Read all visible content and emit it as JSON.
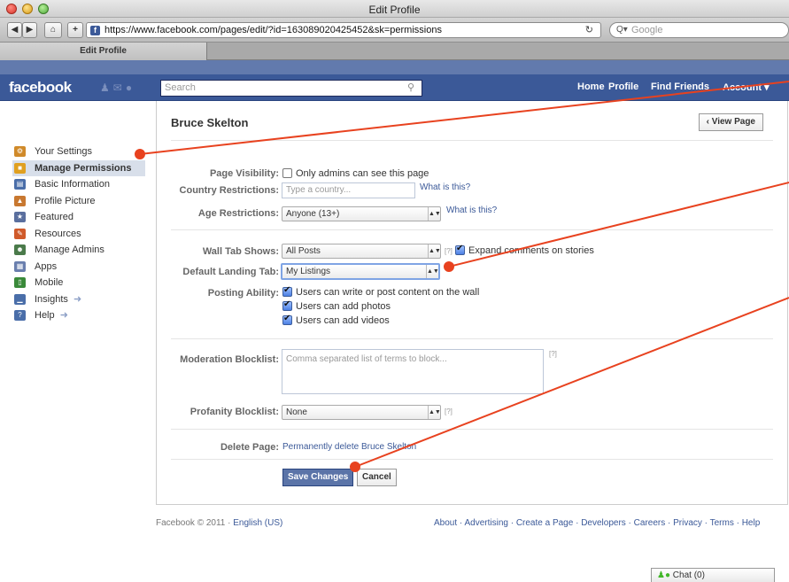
{
  "window": {
    "title": "Edit Profile"
  },
  "browser": {
    "url": "https://www.facebook.com/pages/edit/?id=163089020425452&sk=permissions",
    "search_placeholder": "Google",
    "tab_label": "Edit Profile",
    "add_label": "+"
  },
  "fb_header": {
    "logo": "facebook",
    "search_placeholder": "Search",
    "nav": [
      "Home",
      "Profile",
      "Find Friends",
      "Account ▾"
    ]
  },
  "sidebar": {
    "items": [
      {
        "label": "Your Settings",
        "icon": "settings-icon",
        "color": "#d08a2a"
      },
      {
        "label": "Manage Permissions",
        "icon": "lock-icon",
        "color": "#e0a020"
      },
      {
        "label": "Basic Information",
        "icon": "id-card-icon",
        "color": "#4a6ea9"
      },
      {
        "label": "Profile Picture",
        "icon": "picture-icon",
        "color": "#c87830"
      },
      {
        "label": "Featured",
        "icon": "thumbs-up-icon",
        "color": "#5a6f9e"
      },
      {
        "label": "Resources",
        "icon": "resources-icon",
        "color": "#d05a2a"
      },
      {
        "label": "Manage Admins",
        "icon": "admins-icon",
        "color": "#4a7a4a"
      },
      {
        "label": "Apps",
        "icon": "apps-icon",
        "color": "#6a7fae"
      },
      {
        "label": "Mobile",
        "icon": "mobile-icon",
        "color": "#3a8a3a"
      },
      {
        "label": "Insights",
        "icon": "insights-icon",
        "color": "#4a6ea9"
      },
      {
        "label": "Help",
        "icon": "help-icon",
        "color": "#4a6ea9"
      }
    ],
    "arrow": "➜"
  },
  "page": {
    "title": "Bruce Skelton",
    "view_page": "‹ View Page"
  },
  "form": {
    "page_visibility": {
      "label": "Page Visibility:",
      "text": "Only admins can see this page"
    },
    "country": {
      "label": "Country Restrictions:",
      "placeholder": "Type a country...",
      "help": "What is this?"
    },
    "age": {
      "label": "Age Restrictions:",
      "value": "Anyone (13+)",
      "help": "What is this?"
    },
    "wall_tab": {
      "label": "Wall Tab Shows:",
      "value": "All Posts",
      "q": "[?]",
      "expand_text": "Expand comments on stories"
    },
    "landing_tab": {
      "label": "Default Landing Tab:",
      "value": "My Listings"
    },
    "posting": {
      "label": "Posting Ability:",
      "options": [
        "Users can write or post content on the wall",
        "Users can add photos",
        "Users can add videos"
      ]
    },
    "moderation": {
      "label": "Moderation Blocklist:",
      "placeholder": "Comma separated list of terms to block...",
      "q": "[?]"
    },
    "profanity": {
      "label": "Profanity Blocklist:",
      "value": "None",
      "q": "[?]"
    },
    "delete_page": {
      "label": "Delete Page:",
      "link": "Permanently delete Bruce Skelton"
    },
    "save": "Save Changes",
    "cancel": "Cancel"
  },
  "footer": {
    "copyright": "Facebook © 2011 · ",
    "language": "English (US)",
    "links": "About · Advertising · Create a Page · Developers · Careers · Privacy · Terms · Help"
  },
  "chat": {
    "label": "Chat (0)"
  },
  "colors": {
    "fb_blue": "#3b5998",
    "annotation": "#e8421f"
  }
}
